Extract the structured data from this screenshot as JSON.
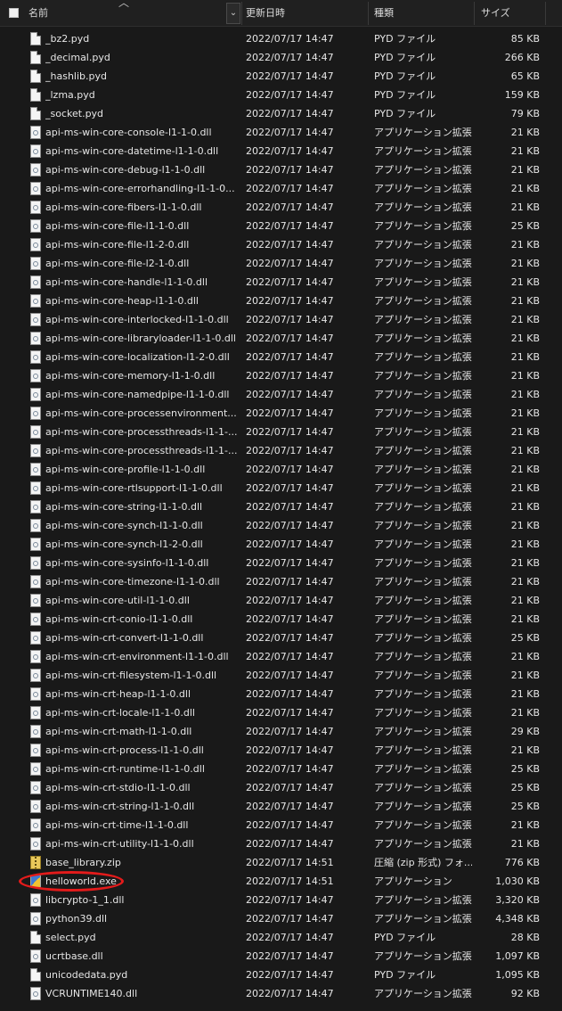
{
  "header": {
    "name": "名前",
    "date": "更新日時",
    "type": "種類",
    "size": "サイズ"
  },
  "icons": {
    "sort": "chevron-up-icon",
    "dropdown": "chevron-down-icon"
  },
  "annotation": {
    "color": "#e41b1b",
    "target": "helloworld.exe"
  },
  "files": [
    {
      "icon": "doc",
      "name": "_bz2.pyd",
      "date": "2022/07/17 14:47",
      "type": "PYD ファイル",
      "size": "85 KB"
    },
    {
      "icon": "doc",
      "name": "_decimal.pyd",
      "date": "2022/07/17 14:47",
      "type": "PYD ファイル",
      "size": "266 KB"
    },
    {
      "icon": "doc",
      "name": "_hashlib.pyd",
      "date": "2022/07/17 14:47",
      "type": "PYD ファイル",
      "size": "65 KB"
    },
    {
      "icon": "doc",
      "name": "_lzma.pyd",
      "date": "2022/07/17 14:47",
      "type": "PYD ファイル",
      "size": "159 KB"
    },
    {
      "icon": "doc",
      "name": "_socket.pyd",
      "date": "2022/07/17 14:47",
      "type": "PYD ファイル",
      "size": "79 KB"
    },
    {
      "icon": "dll",
      "name": "api-ms-win-core-console-l1-1-0.dll",
      "date": "2022/07/17 14:47",
      "type": "アプリケーション拡張",
      "size": "21 KB"
    },
    {
      "icon": "dll",
      "name": "api-ms-win-core-datetime-l1-1-0.dll",
      "date": "2022/07/17 14:47",
      "type": "アプリケーション拡張",
      "size": "21 KB"
    },
    {
      "icon": "dll",
      "name": "api-ms-win-core-debug-l1-1-0.dll",
      "date": "2022/07/17 14:47",
      "type": "アプリケーション拡張",
      "size": "21 KB"
    },
    {
      "icon": "dll",
      "name": "api-ms-win-core-errorhandling-l1-1-0...",
      "date": "2022/07/17 14:47",
      "type": "アプリケーション拡張",
      "size": "21 KB"
    },
    {
      "icon": "dll",
      "name": "api-ms-win-core-fibers-l1-1-0.dll",
      "date": "2022/07/17 14:47",
      "type": "アプリケーション拡張",
      "size": "21 KB"
    },
    {
      "icon": "dll",
      "name": "api-ms-win-core-file-l1-1-0.dll",
      "date": "2022/07/17 14:47",
      "type": "アプリケーション拡張",
      "size": "25 KB"
    },
    {
      "icon": "dll",
      "name": "api-ms-win-core-file-l1-2-0.dll",
      "date": "2022/07/17 14:47",
      "type": "アプリケーション拡張",
      "size": "21 KB"
    },
    {
      "icon": "dll",
      "name": "api-ms-win-core-file-l2-1-0.dll",
      "date": "2022/07/17 14:47",
      "type": "アプリケーション拡張",
      "size": "21 KB"
    },
    {
      "icon": "dll",
      "name": "api-ms-win-core-handle-l1-1-0.dll",
      "date": "2022/07/17 14:47",
      "type": "アプリケーション拡張",
      "size": "21 KB"
    },
    {
      "icon": "dll",
      "name": "api-ms-win-core-heap-l1-1-0.dll",
      "date": "2022/07/17 14:47",
      "type": "アプリケーション拡張",
      "size": "21 KB"
    },
    {
      "icon": "dll",
      "name": "api-ms-win-core-interlocked-l1-1-0.dll",
      "date": "2022/07/17 14:47",
      "type": "アプリケーション拡張",
      "size": "21 KB"
    },
    {
      "icon": "dll",
      "name": "api-ms-win-core-libraryloader-l1-1-0.dll",
      "date": "2022/07/17 14:47",
      "type": "アプリケーション拡張",
      "size": "21 KB"
    },
    {
      "icon": "dll",
      "name": "api-ms-win-core-localization-l1-2-0.dll",
      "date": "2022/07/17 14:47",
      "type": "アプリケーション拡張",
      "size": "21 KB"
    },
    {
      "icon": "dll",
      "name": "api-ms-win-core-memory-l1-1-0.dll",
      "date": "2022/07/17 14:47",
      "type": "アプリケーション拡張",
      "size": "21 KB"
    },
    {
      "icon": "dll",
      "name": "api-ms-win-core-namedpipe-l1-1-0.dll",
      "date": "2022/07/17 14:47",
      "type": "アプリケーション拡張",
      "size": "21 KB"
    },
    {
      "icon": "dll",
      "name": "api-ms-win-core-processenvironment...",
      "date": "2022/07/17 14:47",
      "type": "アプリケーション拡張",
      "size": "21 KB"
    },
    {
      "icon": "dll",
      "name": "api-ms-win-core-processthreads-l1-1-...",
      "date": "2022/07/17 14:47",
      "type": "アプリケーション拡張",
      "size": "21 KB"
    },
    {
      "icon": "dll",
      "name": "api-ms-win-core-processthreads-l1-1-...",
      "date": "2022/07/17 14:47",
      "type": "アプリケーション拡張",
      "size": "21 KB"
    },
    {
      "icon": "dll",
      "name": "api-ms-win-core-profile-l1-1-0.dll",
      "date": "2022/07/17 14:47",
      "type": "アプリケーション拡張",
      "size": "21 KB"
    },
    {
      "icon": "dll",
      "name": "api-ms-win-core-rtlsupport-l1-1-0.dll",
      "date": "2022/07/17 14:47",
      "type": "アプリケーション拡張",
      "size": "21 KB"
    },
    {
      "icon": "dll",
      "name": "api-ms-win-core-string-l1-1-0.dll",
      "date": "2022/07/17 14:47",
      "type": "アプリケーション拡張",
      "size": "21 KB"
    },
    {
      "icon": "dll",
      "name": "api-ms-win-core-synch-l1-1-0.dll",
      "date": "2022/07/17 14:47",
      "type": "アプリケーション拡張",
      "size": "21 KB"
    },
    {
      "icon": "dll",
      "name": "api-ms-win-core-synch-l1-2-0.dll",
      "date": "2022/07/17 14:47",
      "type": "アプリケーション拡張",
      "size": "21 KB"
    },
    {
      "icon": "dll",
      "name": "api-ms-win-core-sysinfo-l1-1-0.dll",
      "date": "2022/07/17 14:47",
      "type": "アプリケーション拡張",
      "size": "21 KB"
    },
    {
      "icon": "dll",
      "name": "api-ms-win-core-timezone-l1-1-0.dll",
      "date": "2022/07/17 14:47",
      "type": "アプリケーション拡張",
      "size": "21 KB"
    },
    {
      "icon": "dll",
      "name": "api-ms-win-core-util-l1-1-0.dll",
      "date": "2022/07/17 14:47",
      "type": "アプリケーション拡張",
      "size": "21 KB"
    },
    {
      "icon": "dll",
      "name": "api-ms-win-crt-conio-l1-1-0.dll",
      "date": "2022/07/17 14:47",
      "type": "アプリケーション拡張",
      "size": "21 KB"
    },
    {
      "icon": "dll",
      "name": "api-ms-win-crt-convert-l1-1-0.dll",
      "date": "2022/07/17 14:47",
      "type": "アプリケーション拡張",
      "size": "25 KB"
    },
    {
      "icon": "dll",
      "name": "api-ms-win-crt-environment-l1-1-0.dll",
      "date": "2022/07/17 14:47",
      "type": "アプリケーション拡張",
      "size": "21 KB"
    },
    {
      "icon": "dll",
      "name": "api-ms-win-crt-filesystem-l1-1-0.dll",
      "date": "2022/07/17 14:47",
      "type": "アプリケーション拡張",
      "size": "21 KB"
    },
    {
      "icon": "dll",
      "name": "api-ms-win-crt-heap-l1-1-0.dll",
      "date": "2022/07/17 14:47",
      "type": "アプリケーション拡張",
      "size": "21 KB"
    },
    {
      "icon": "dll",
      "name": "api-ms-win-crt-locale-l1-1-0.dll",
      "date": "2022/07/17 14:47",
      "type": "アプリケーション拡張",
      "size": "21 KB"
    },
    {
      "icon": "dll",
      "name": "api-ms-win-crt-math-l1-1-0.dll",
      "date": "2022/07/17 14:47",
      "type": "アプリケーション拡張",
      "size": "29 KB"
    },
    {
      "icon": "dll",
      "name": "api-ms-win-crt-process-l1-1-0.dll",
      "date": "2022/07/17 14:47",
      "type": "アプリケーション拡張",
      "size": "21 KB"
    },
    {
      "icon": "dll",
      "name": "api-ms-win-crt-runtime-l1-1-0.dll",
      "date": "2022/07/17 14:47",
      "type": "アプリケーション拡張",
      "size": "25 KB"
    },
    {
      "icon": "dll",
      "name": "api-ms-win-crt-stdio-l1-1-0.dll",
      "date": "2022/07/17 14:47",
      "type": "アプリケーション拡張",
      "size": "25 KB"
    },
    {
      "icon": "dll",
      "name": "api-ms-win-crt-string-l1-1-0.dll",
      "date": "2022/07/17 14:47",
      "type": "アプリケーション拡張",
      "size": "25 KB"
    },
    {
      "icon": "dll",
      "name": "api-ms-win-crt-time-l1-1-0.dll",
      "date": "2022/07/17 14:47",
      "type": "アプリケーション拡張",
      "size": "21 KB"
    },
    {
      "icon": "dll",
      "name": "api-ms-win-crt-utility-l1-1-0.dll",
      "date": "2022/07/17 14:47",
      "type": "アプリケーション拡張",
      "size": "21 KB"
    },
    {
      "icon": "zip",
      "name": "base_library.zip",
      "date": "2022/07/17 14:51",
      "type": "圧縮 (zip 形式) フォ...",
      "size": "776 KB"
    },
    {
      "icon": "exe",
      "name": "helloworld.exe",
      "date": "2022/07/17 14:51",
      "type": "アプリケーション",
      "size": "1,030 KB"
    },
    {
      "icon": "dll",
      "name": "libcrypto-1_1.dll",
      "date": "2022/07/17 14:47",
      "type": "アプリケーション拡張",
      "size": "3,320 KB"
    },
    {
      "icon": "dll",
      "name": "python39.dll",
      "date": "2022/07/17 14:47",
      "type": "アプリケーション拡張",
      "size": "4,348 KB"
    },
    {
      "icon": "doc",
      "name": "select.pyd",
      "date": "2022/07/17 14:47",
      "type": "PYD ファイル",
      "size": "28 KB"
    },
    {
      "icon": "dll",
      "name": "ucrtbase.dll",
      "date": "2022/07/17 14:47",
      "type": "アプリケーション拡張",
      "size": "1,097 KB"
    },
    {
      "icon": "doc",
      "name": "unicodedata.pyd",
      "date": "2022/07/17 14:47",
      "type": "PYD ファイル",
      "size": "1,095 KB"
    },
    {
      "icon": "dll",
      "name": "VCRUNTIME140.dll",
      "date": "2022/07/17 14:47",
      "type": "アプリケーション拡張",
      "size": "92 KB"
    }
  ]
}
